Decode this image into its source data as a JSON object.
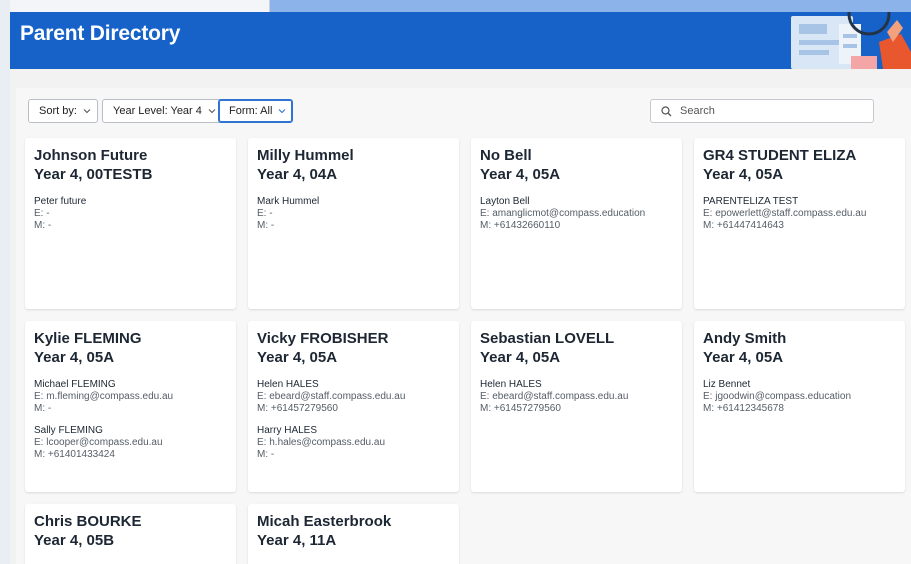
{
  "dialog": {
    "title": "Parent Directory"
  },
  "toolbar": {
    "sort_label": "Sort by:",
    "year_level_label": "Year Level: Year 4",
    "form_label": "Form: All",
    "search_placeholder": "Search"
  },
  "cards": [
    {
      "name": "Johnson Future",
      "year": "Year 4, 00TESTB",
      "parents": [
        {
          "name": "Peter future",
          "email": "E: -",
          "mobile": "M: -"
        }
      ]
    },
    {
      "name": "Milly Hummel",
      "year": "Year 4, 04A",
      "parents": [
        {
          "name": "Mark Hummel",
          "email": "E: -",
          "mobile": "M: -"
        }
      ]
    },
    {
      "name": "No Bell",
      "year": "Year 4, 05A",
      "parents": [
        {
          "name": "Layton Bell",
          "email": "E: amanglicmot@compass.education",
          "mobile": "M: +61432660110"
        }
      ]
    },
    {
      "name": "GR4 STUDENT ELIZA",
      "year": "Year 4, 05A",
      "parents": [
        {
          "name": "PARENTELIZA TEST",
          "email": "E: epowerlett@staff.compass.edu.au",
          "mobile": "M: +61447414643"
        }
      ]
    },
    {
      "name": "Kylie FLEMING",
      "year": "Year 4, 05A",
      "parents": [
        {
          "name": "Michael FLEMING",
          "email": "E: m.fleming@compass.edu.au",
          "mobile": "M: -"
        },
        {
          "name": "Sally FLEMING",
          "email": "E: lcooper@compass.edu.au",
          "mobile": "M: +61401433424"
        }
      ]
    },
    {
      "name": "Vicky FROBISHER",
      "year": "Year 4, 05A",
      "parents": [
        {
          "name": "Helen HALES",
          "email": "E: ebeard@staff.compass.edu.au",
          "mobile": "M: +61457279560"
        },
        {
          "name": "Harry HALES",
          "email": "E: h.hales@compass.edu.au",
          "mobile": "M: -"
        }
      ]
    },
    {
      "name": "Sebastian LOVELL",
      "year": "Year 4, 05A",
      "parents": [
        {
          "name": "Helen HALES",
          "email": "E: ebeard@staff.compass.edu.au",
          "mobile": "M: +61457279560"
        }
      ]
    },
    {
      "name": "Andy Smith",
      "year": "Year 4, 05A",
      "parents": [
        {
          "name": "Liz Bennet",
          "email": "E: jgoodwin@compass.education",
          "mobile": "M: +61412345678"
        }
      ]
    },
    {
      "name": "Chris BOURKE",
      "year": "Year 4, 05B",
      "parents": []
    },
    {
      "name": "Micah Easterbrook",
      "year": "Year 4, 11A",
      "parents": []
    }
  ],
  "colors": {
    "header": "#1662c8",
    "accent": "#2f74d0"
  }
}
